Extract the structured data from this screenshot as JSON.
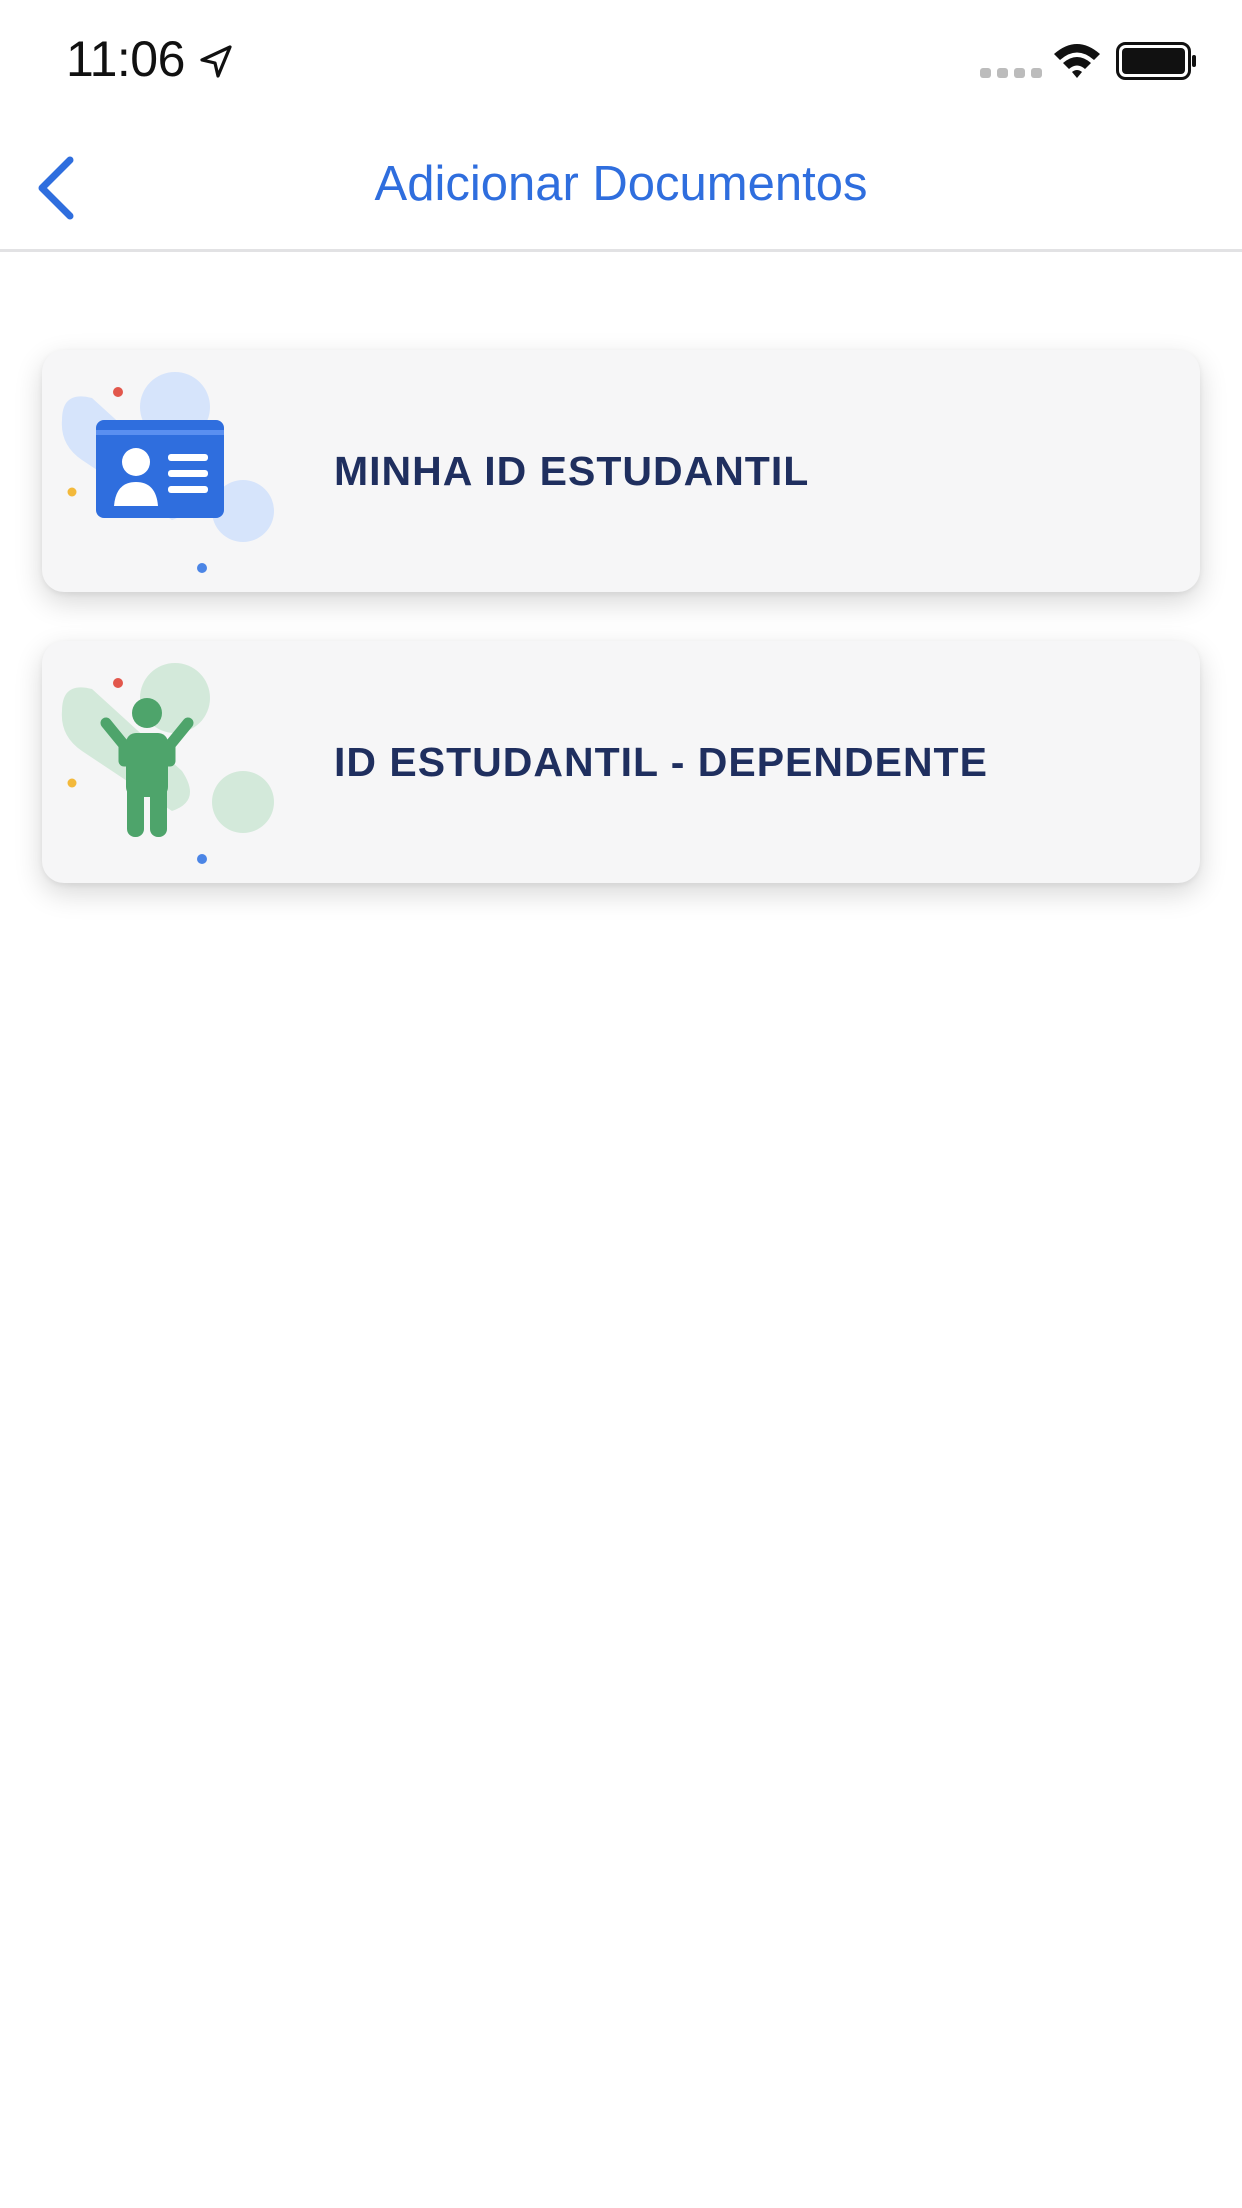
{
  "status_bar": {
    "time": "11:06",
    "icons": [
      "location-arrow-icon",
      "cellular-signal-icon",
      "wifi-icon",
      "battery-icon"
    ]
  },
  "nav": {
    "title": "Adicionar Documentos",
    "back_icon": "chevron-left-icon"
  },
  "options": [
    {
      "label": "MINHA ID ESTUDANTIL",
      "icon": "student-id-card-icon",
      "accent": "#2f6ede"
    },
    {
      "label": "ID ESTUDANTIL - DEPENDENTE",
      "icon": "child-person-icon",
      "accent": "#4ea46b"
    }
  ],
  "colors": {
    "accent_blue": "#2f6ede",
    "label_navy": "#1f2f5f",
    "card_background": "#f6f6f7",
    "dependent_green": "#4ea46b"
  }
}
